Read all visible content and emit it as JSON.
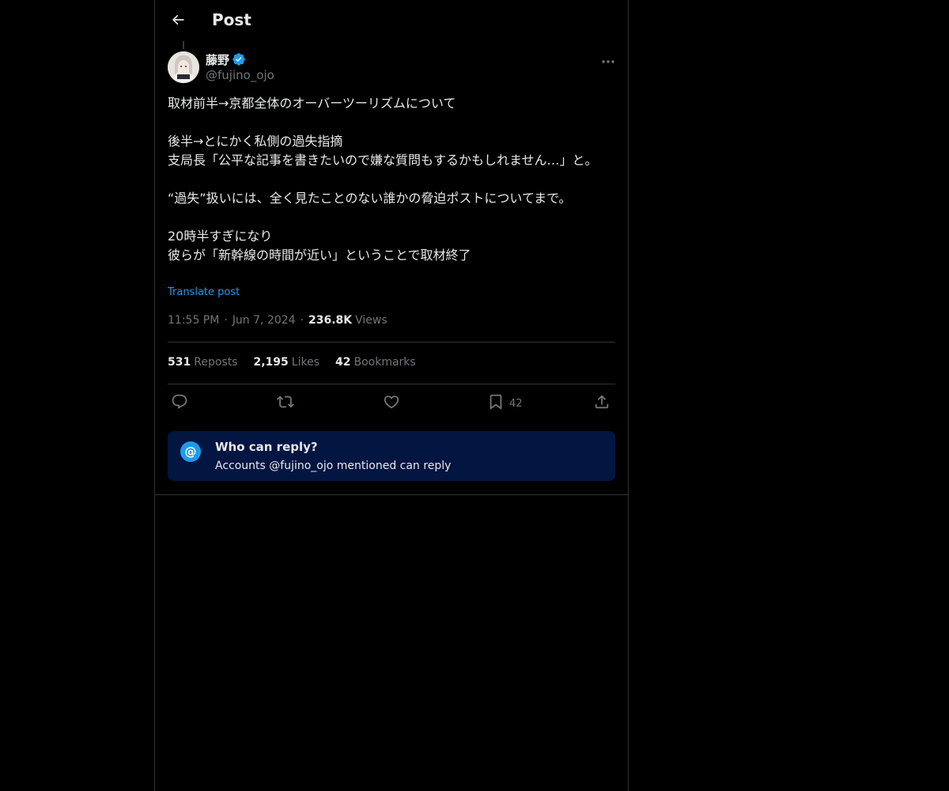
{
  "header": {
    "title": "Post",
    "back_icon": "arrow-left-icon"
  },
  "author": {
    "display_name": "藤野",
    "handle": "@fujino_ojo",
    "verified": true,
    "verified_color": "#1d9bf0"
  },
  "tweet": {
    "text": "取材前半→京都全体のオーバーツーリズムについて\n\n後半→とにかく私側の過失指摘\n支局長「公平な記事を書きたいので嫌な質問もするかもしれません…」と。\n\n“過失”扱いには、全く見たことのない誰かの脅迫ポストについてまで。\n\n20時半すぎになり\n彼らが「新幹線の時間が近い」ということで取材終了",
    "translate_label": "Translate post",
    "time": "11:55 PM",
    "date": "Jun 7, 2024",
    "views_count": "236.8K",
    "views_label": "Views"
  },
  "stats": {
    "reposts_count": "531",
    "reposts_label": "Reposts",
    "likes_count": "2,195",
    "likes_label": "Likes",
    "bookmarks_count": "42",
    "bookmarks_label": "Bookmarks"
  },
  "actions": {
    "reply_icon": "reply-icon",
    "repost_icon": "repost-icon",
    "like_icon": "heart-icon",
    "bookmark_icon": "bookmark-icon",
    "bookmark_count": "42",
    "share_icon": "share-icon"
  },
  "reply_restriction": {
    "title": "Who can reply?",
    "subtitle": "Accounts @fujino_ojo mentioned can reply",
    "icon_glyph": "@",
    "background": "#031541",
    "accent": "#1d9bf0"
  },
  "colors": {
    "background": "#000000",
    "text": "#e7e9ea",
    "muted": "#71767b",
    "border": "#2f3336",
    "link": "#1d9bf0"
  }
}
